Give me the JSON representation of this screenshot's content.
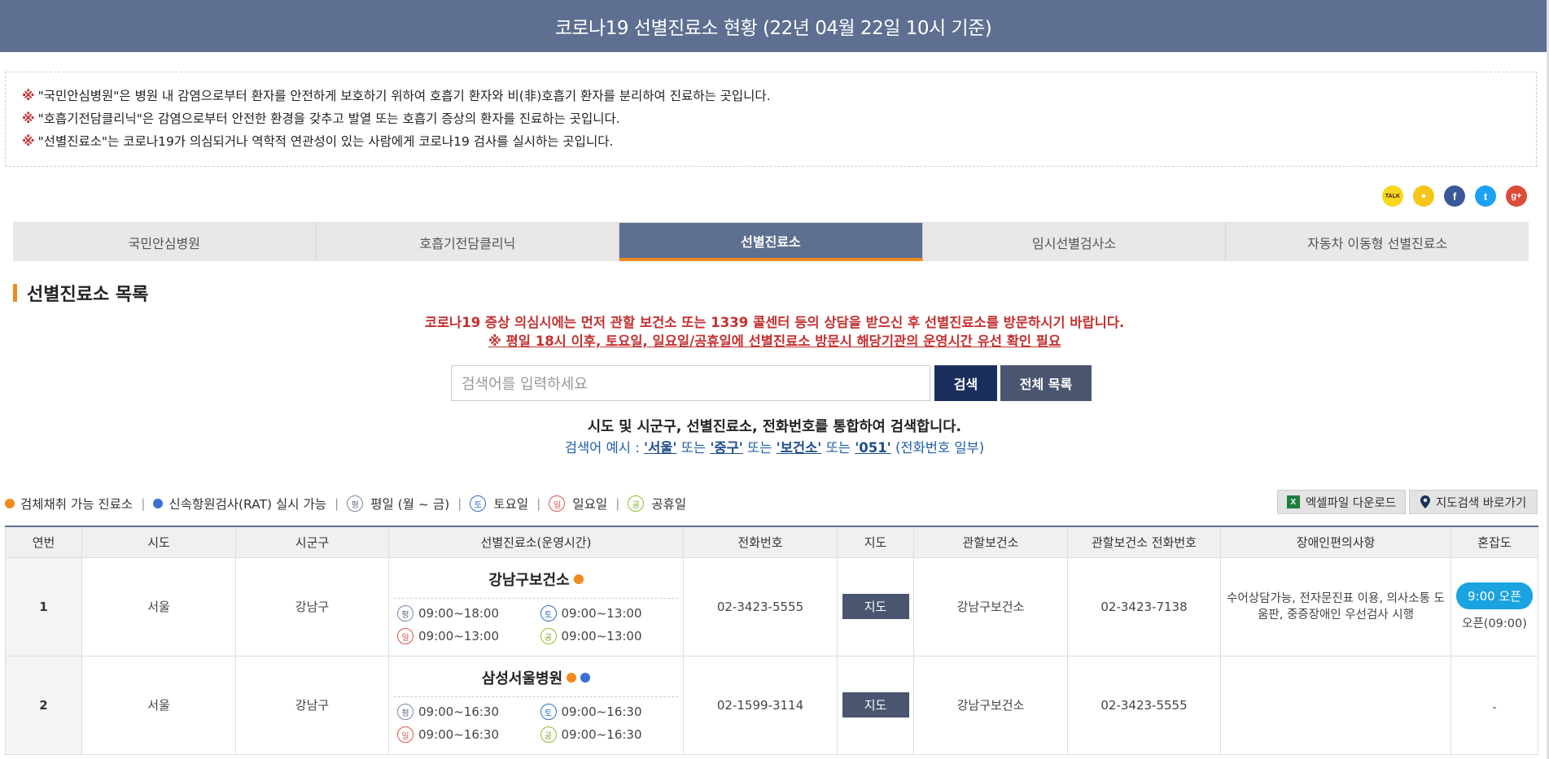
{
  "header": {
    "title": "코로나19 선별진료소 현황 (22년 04월 22일 10시 기준)"
  },
  "notice": {
    "mark": "※",
    "lines": [
      "\"국민안심병원\"은 병원 내 감염으로부터 환자를 안전하게 보호하기 위하여 호흡기 환자와 비(非)호흡기 환자를 분리하여 진료하는 곳입니다.",
      "\"호흡기전담클리닉\"은 감염으로부터 안전한 환경을 갖추고 발열 또는 호흡기 증상의 환자를 진료하는 곳입니다.",
      "\"선별진료소\"는 코로나19가 의심되거나 역학적 연관성이 있는 사람에게 코로나19 검사를 실시하는 곳입니다."
    ]
  },
  "social": {
    "kakao": "TALK",
    "story": "●",
    "facebook": "f",
    "twitter": "t",
    "google": "g+"
  },
  "tabs": [
    {
      "label": "국민안심병원"
    },
    {
      "label": "호흡기전담클리닉"
    },
    {
      "label": "선별진료소"
    },
    {
      "label": "임시선별검사소"
    },
    {
      "label": "자동차 이동형 선별진료소"
    }
  ],
  "section": {
    "title": "선별진료소 목록"
  },
  "warning": {
    "line1": "코로나19 증상 의심시에는 먼저 관할 보건소 또는 1339 콜센터 등의 상담을 받으신 후 선별진료소를 방문하시기 바랍니다.",
    "line2": "※ 평일 18시 이후, 토요일, 일요일/공휴일에 선별진료소 방문시 해당기관의 운영시간 유선 확인 필요"
  },
  "search": {
    "placeholder": "검색어를 입력하세요",
    "button": "검색",
    "all_button": "전체 목록",
    "desc": "시도 및 시군구, 선별진료소, 전화번호를 통합하여 검색합니다.",
    "example_prefix": "검색어 예시 : ",
    "ex1": "'서울'",
    "or1": " 또는 ",
    "ex2": "'중구'",
    "or2": " 또는 ",
    "ex3": "'보건소'",
    "or3": " 또는 ",
    "ex4": "'051'",
    "example_suffix": " (전화번호 일부)"
  },
  "legend": {
    "specimen": "검체채취 가능 진료소",
    "rat": "신속항원검사(RAT) 실시 가능",
    "weekday": "평일 (월 ~ 금)",
    "saturday": "토요일",
    "sunday": "일요일",
    "holiday": "공휴일",
    "sep": "|"
  },
  "day_glyphs": {
    "weekday": "평",
    "saturday": "토",
    "sunday": "일",
    "holiday": "공"
  },
  "buttons": {
    "excel": "엑셀파일 다운로드",
    "map_search": "지도검색 바로가기",
    "xl": "X"
  },
  "table": {
    "headers": [
      "연번",
      "시도",
      "시군구",
      "선별진료소(운영시간)",
      "전화번호",
      "지도",
      "관할보건소",
      "관할보건소 전화번호",
      "장애인편의사항",
      "혼잡도"
    ],
    "rows": [
      {
        "no": "1",
        "sido": "서울",
        "sigungu": "강남구",
        "name": "강남구보건소",
        "weekday": "09:00~18:00",
        "saturday": "09:00~13:00",
        "sunday": "09:00~13:00",
        "holiday": "09:00~13:00",
        "phone": "02-3423-5555",
        "map": "지도",
        "center": "강남구보건소",
        "center_phone": "02-3423-7138",
        "access": "수어상담가능, 전자문진표 이용, 의사소통 도움판, 중증장애인 우선검사 시행",
        "crowd_badge": "9:00 오픈",
        "crowd_text": "오픈(09:00)"
      },
      {
        "no": "2",
        "sido": "서울",
        "sigungu": "강남구",
        "name": "삼성서울병원",
        "weekday": "09:00~16:30",
        "saturday": "09:00~16:30",
        "sunday": "09:00~16:30",
        "holiday": "09:00~16:30",
        "phone": "02-1599-3114",
        "map": "지도",
        "center": "강남구보건소",
        "center_phone": "02-3423-5555",
        "access": "",
        "crowd_text": "-"
      }
    ]
  },
  "colors": {
    "header": "#5e6f91",
    "accent": "#f08a1c",
    "warning": "#c53030",
    "search_btn": "#1b2f5c",
    "crowd_badge": "#1aa3e0"
  }
}
